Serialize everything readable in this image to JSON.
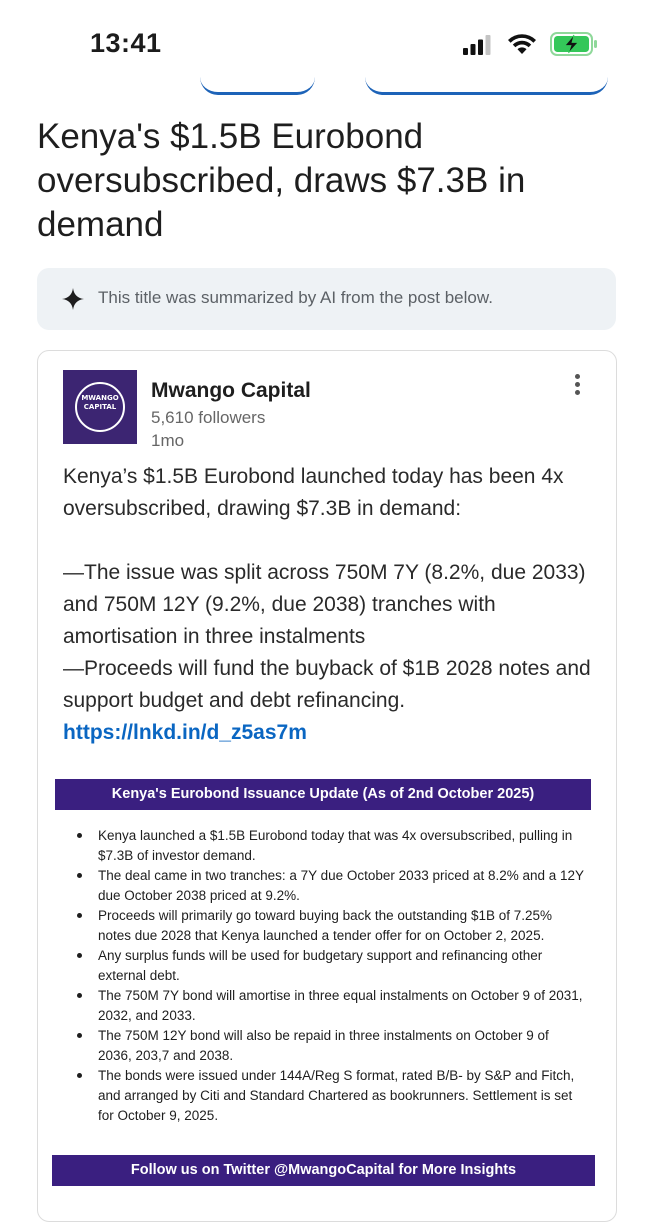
{
  "status_bar": {
    "time": "13:41"
  },
  "headline": "Kenya's $1.5B Eurobond oversubscribed, draws $7.3B in demand",
  "ai_notice": {
    "text": "This title was summarized by AI from the post below.",
    "icon": "sparkle-icon"
  },
  "post": {
    "author": "Mwango Capital",
    "followers": "5,610 followers",
    "age": "1mo",
    "logo_text_line1": "MWANGO",
    "logo_text_line2": "CAPITAL",
    "body_intro": "Kenya’s $1.5B Eurobond launched today has been 4x oversubscribed, drawing $7.3B in demand:",
    "body_point1": "—The issue was split across 750M 7Y (8.2%, due 2033) and 750M 12Y (9.2%, due 2038) tranches with amortisation in three instalments",
    "body_point2": "—Proceeds will fund the buyback of $1B 2028 notes and support budget and debt refinancing.",
    "link": "https://lnkd.in/d_z5as7m"
  },
  "infographic": {
    "title": "Kenya's Eurobond Issuance Update (As of 2nd October 2025)",
    "bullets": [
      "Kenya launched a $1.5B Eurobond today that was 4x oversubscribed, pulling in $7.3B of investor demand.",
      "The deal came in two tranches: a 7Y due October 2033 priced at 8.2% and a 12Y due October 2038 priced at 9.2%.",
      "Proceeds will primarily go toward buying back the outstanding $1B of 7.25% notes due 2028 that Kenya launched a tender offer for on October 2, 2025.",
      "Any surplus funds will be used for budgetary support and refinancing other external debt.",
      "The 750M 7Y bond will amortise in three equal instalments on October 9 of 2031, 2032, and 2033.",
      "The 750M 12Y bond will also be repaid in three instalments on October 9 of 2036, 203,7 and 2038.",
      "The bonds were issued under 144A/Reg S format, rated B/B- by S&P and Fitch, and arranged by Citi and Standard Chartered as bookrunners. Settlement is set for October 9, 2025."
    ],
    "footer": "Follow us on Twitter @MwangoCapital for More Insights"
  },
  "colors": {
    "brand_purple": "#3a1f80",
    "link_blue": "#0a66c2"
  }
}
